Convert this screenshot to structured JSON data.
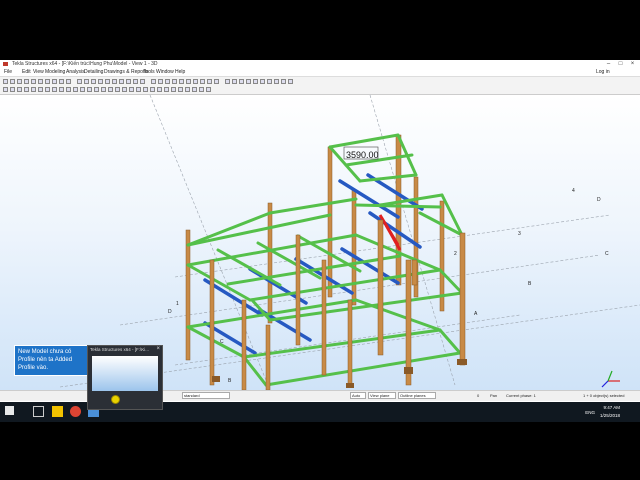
{
  "window": {
    "title": "Tekla Structures x64 - [F:\\Kiến trúc\\Hung Phu\\Model - View 1 - 3D",
    "login_label": "Log in"
  },
  "menu": [
    "File",
    "Edit",
    "View",
    "Modeling",
    "Analysis",
    "Detailing",
    "Drawings & Reports",
    "Tools",
    "Window",
    "Help"
  ],
  "model": {
    "dimension_label": "3590.00",
    "grid_labels_letters": [
      "D",
      "C",
      "B",
      "A",
      "D",
      "C",
      "B",
      "A"
    ],
    "grid_labels_numbers": [
      "1",
      "2",
      "3",
      "4",
      "4",
      "3",
      "2",
      "1"
    ],
    "colors": {
      "column": "#c88a46",
      "beam_green": "#55c04a",
      "beam_blue": "#2659c2",
      "highlight": "#e02020"
    }
  },
  "statusbar": {
    "select_filter": "standard",
    "snap_mode": "Auto",
    "plane_1": "View plane",
    "plane_2": "Outline planes",
    "value": "0",
    "pan_label": "Pan",
    "phase_label": "Current phase: 1",
    "selection_info": "1 + 0 object(s) selected"
  },
  "tooltip": {
    "text": "New Model chưa có Profile nên ta Added Profile vào."
  },
  "preview": {
    "title": "Tekla Structures x64 - [F:\\Ki..."
  },
  "taskbar": {
    "time": "9:47 AM",
    "date": "1/25/2018",
    "language": "ENG"
  }
}
